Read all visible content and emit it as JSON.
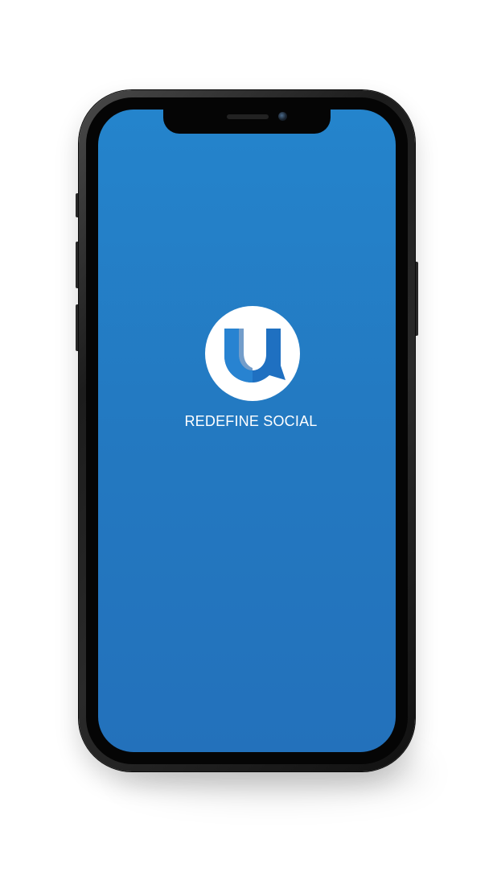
{
  "app": {
    "tagline": "REDEFINE SOCIAL",
    "logo_letter": "U",
    "logo_icon": "u-speech-bubble-logo-icon"
  },
  "colors": {
    "screen_top": "#2484cc",
    "screen_bottom": "#2371bb",
    "logo_background": "#ffffff",
    "logo_mark": "#1f70c1",
    "tagline": "#ffffff",
    "page_background": "#ffffff"
  }
}
